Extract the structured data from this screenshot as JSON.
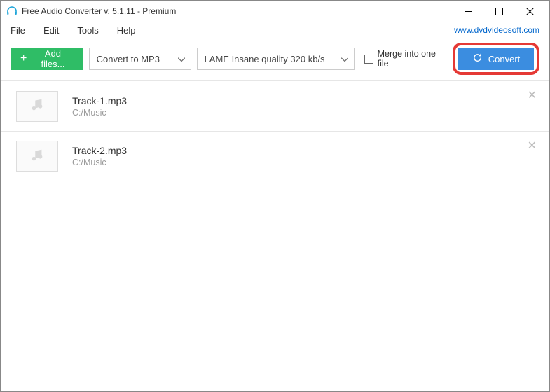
{
  "window": {
    "title": "Free Audio Converter v. 5.1.11 - Premium",
    "site_link": "www.dvdvideosoft.com"
  },
  "menu": {
    "file": "File",
    "edit": "Edit",
    "tools": "Tools",
    "help": "Help"
  },
  "toolbar": {
    "add_files_label": "Add files...",
    "format_selected": "Convert to MP3",
    "quality_selected": "LAME Insane quality 320 kb/s",
    "merge_label": "Merge into one file",
    "convert_label": "Convert"
  },
  "files": [
    {
      "name": "Track-1.mp3",
      "path": "C:/Music"
    },
    {
      "name": "Track-2.mp3",
      "path": "C:/Music"
    }
  ],
  "colors": {
    "accent_green": "#2fbd66",
    "accent_blue": "#3b8de0",
    "highlight_red": "#e53935"
  }
}
